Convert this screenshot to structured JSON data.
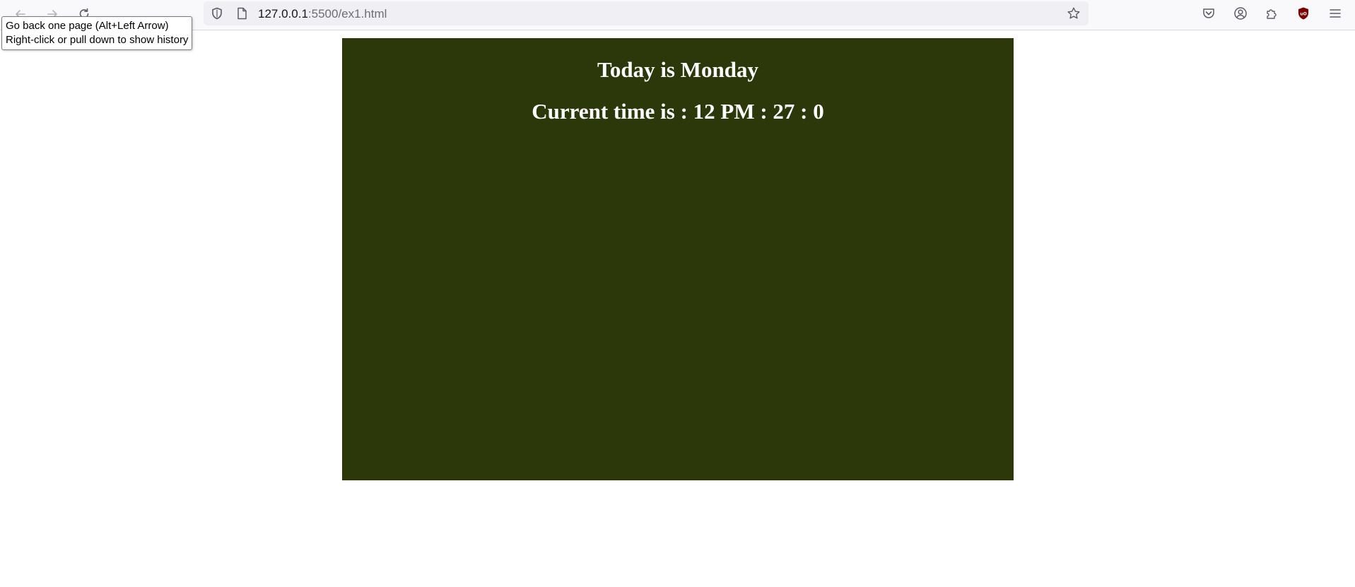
{
  "browser": {
    "url_host": "127.0.0.1",
    "url_path": ":5500/ex1.html",
    "tooltip": {
      "line1": "Go back one page (Alt+Left Arrow)",
      "line2": "Right-click or pull down to show history"
    },
    "icons": {
      "back": "back-arrow-icon",
      "forward": "forward-arrow-icon",
      "reload": "reload-icon",
      "shield": "tracking-protection-shield-icon",
      "page": "page-info-icon",
      "bookmark": "bookmark-star-icon",
      "pocket": "pocket-icon",
      "account": "account-icon",
      "extensions": "extensions-icon",
      "ublock": "ublock-origin-icon",
      "menu": "hamburger-menu-icon"
    }
  },
  "page": {
    "day_text": "Today is Monday",
    "time_text": "Current time is : 12 PM : 27 : 0",
    "panel_color": "#2c370a",
    "text_color": "#ffffff"
  }
}
